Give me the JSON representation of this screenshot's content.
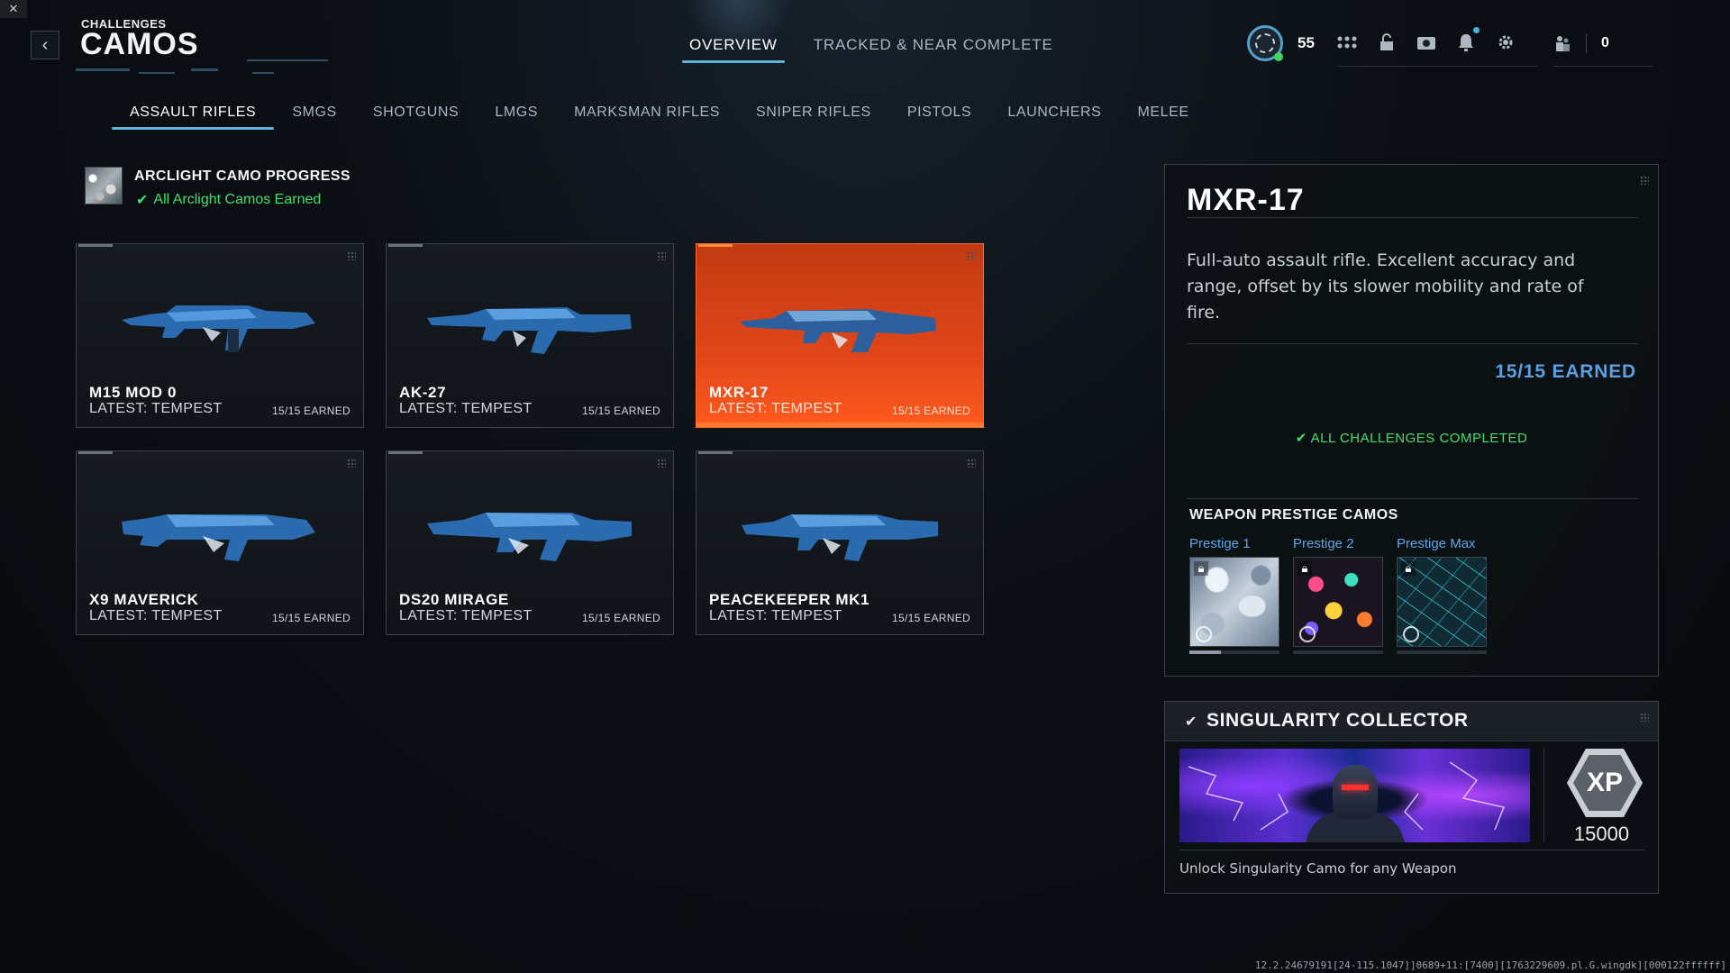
{
  "header": {
    "breadcrumb": "CHALLENGES",
    "title": "CAMOS",
    "tabs": [
      {
        "label": "OVERVIEW",
        "active": true
      },
      {
        "label": "TRACKED & NEAR COMPLETE",
        "active": false
      }
    ]
  },
  "player": {
    "level": "55",
    "friends_count": "0",
    "status_color": "#45d35a"
  },
  "categories": [
    {
      "label": "ASSAULT RIFLES",
      "active": true
    },
    {
      "label": "SMGS",
      "active": false
    },
    {
      "label": "SHOTGUNS",
      "active": false
    },
    {
      "label": "LMGS",
      "active": false
    },
    {
      "label": "MARKSMAN RIFLES",
      "active": false
    },
    {
      "label": "SNIPER RIFLES",
      "active": false
    },
    {
      "label": "PISTOLS",
      "active": false
    },
    {
      "label": "LAUNCHERS",
      "active": false
    },
    {
      "label": "MELEE",
      "active": false
    }
  ],
  "arclight": {
    "title": "ARCLIGHT CAMO PROGRESS",
    "status": "All Arclight Camos Earned"
  },
  "weapons": [
    {
      "name": "M15 MOD 0",
      "latest": "LATEST: TEMPEST",
      "earned": "15/15 EARNED",
      "selected": false
    },
    {
      "name": "AK-27",
      "latest": "LATEST: TEMPEST",
      "earned": "15/15 EARNED",
      "selected": false
    },
    {
      "name": "MXR-17",
      "latest": "LATEST: TEMPEST",
      "earned": "15/15 EARNED",
      "selected": true
    },
    {
      "name": "X9 MAVERICK",
      "latest": "LATEST: TEMPEST",
      "earned": "15/15 EARNED",
      "selected": false
    },
    {
      "name": "DS20 MIRAGE",
      "latest": "LATEST: TEMPEST",
      "earned": "15/15 EARNED",
      "selected": false
    },
    {
      "name": "PEACEKEEPER MK1",
      "latest": "LATEST: TEMPEST",
      "earned": "15/15 EARNED",
      "selected": false
    }
  ],
  "detail": {
    "title": "MXR-17",
    "description": "Full-auto assault rifle. Excellent accuracy and range, offset by its slower mobility and rate of fire.",
    "earned": "15/15 EARNED",
    "completed": "ALL CHALLENGES COMPLETED",
    "prestige_header": "WEAPON PRESTIGE CAMOS",
    "prestige": [
      {
        "label": "Prestige 1",
        "locked": true,
        "progress": 0.35
      },
      {
        "label": "Prestige 2",
        "locked": true,
        "progress": 0
      },
      {
        "label": "Prestige Max",
        "locked": true,
        "progress": 0
      }
    ]
  },
  "singularity": {
    "title": "SINGULARITY COLLECTOR",
    "xp_label": "XP",
    "xp_value": "15000",
    "description": "Unlock Singularity Camo for any Weapon"
  },
  "version": "12.2.24679191[24-115.1047]]0689+11:[7400][1763229609.pl.G.wingdk][000122ffffff]",
  "colors": {
    "accent": "#5fb3d9",
    "selected_card": "#e0461a",
    "success": "#3fe06a",
    "earned": "#5a9fe0"
  }
}
